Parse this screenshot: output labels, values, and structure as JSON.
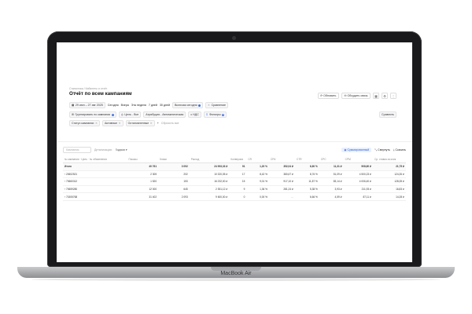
{
  "device": {
    "label": "MacBook Air"
  },
  "breadcrumb": "Статистика / Кабинеты и отчёт",
  "page_title": "Отчёт по всем кампаниям",
  "header_actions": {
    "update": "Обновить",
    "share": "Обсудить связь"
  },
  "filters_row1": {
    "period": "29 июн – 27 авг 2025",
    "today": "Сегодня",
    "yesterday": "Вчера",
    "week": "Эта неделя",
    "days7": "7 дней",
    "days30": "30 дней",
    "all_period": "Включая сегодня",
    "compare": "Сравнение"
  },
  "filters_row2": {
    "grouping": "Группировать по кампании",
    "goal": "Цель - Все",
    "attribution": "Атрибуция - Автоматическая",
    "vat": "с НДС",
    "filters": "Фильтры",
    "filters_count": "3"
  },
  "filters_row3": {
    "status": "Статус кампании",
    "active": "Активные",
    "paused": "Остановленные",
    "reset": "Сбросить все"
  },
  "compare_badge": "Сравнить",
  "toolbar": {
    "search_placeholder": "Кампания",
    "detail_label": "Детализация:",
    "detail_value": "Годами",
    "sum_btn": "Суммированный",
    "collapse": "Свернуть",
    "export": "Скачать"
  },
  "table": {
    "columns": [
      "№ кампании · Цель · № объявления",
      "Показы",
      "Клики",
      "Расход",
      "Конверсии",
      "CR",
      "CPA",
      "CTR",
      "CPC",
      "CPM",
      "Ср. ставка за клик"
    ],
    "total": [
      "Итого",
      "40 761",
      "3 092",
      "24 993,33 ₽",
      "91",
      "1,20 %",
      "352,04 ₽",
      "6,60 %",
      "11,31 ₽",
      "508,60 ₽",
      "21,75 ₽"
    ],
    "rows": [
      [
        "20602521",
        "2 305",
        "202",
        "10 320,05 ₽",
        "17",
        "8,42 %",
        "380,67 ₽",
        "8,76 %",
        "51,09 ₽",
        "4 500,23 ₽",
        "124,26 ₽"
      ],
      [
        "70660312",
        "1 520",
        "153",
        "16 232,00 ₽",
        "15",
        "9,01 %",
        "917,10 ₽",
        "11,87 %",
        "83,14 ₽",
        "4 006,40 ₽",
        "128,28 ₽"
      ],
      [
        "70659280",
        "12 000",
        "645",
        "2 531,12 ₽",
        "9",
        "1,36 %",
        "281,24 ₽",
        "5,38 %",
        "3,93 ₽",
        "211,93 ₽",
        "16,83 ₽"
      ],
      [
        "71505768",
        "31 402",
        "2 093",
        "9 600,00 ₽",
        "0",
        "0,00 %",
        "—",
        "6,66 %",
        "4,59 ₽",
        "87,11 ₽",
        "14,28 ₽"
      ]
    ]
  }
}
